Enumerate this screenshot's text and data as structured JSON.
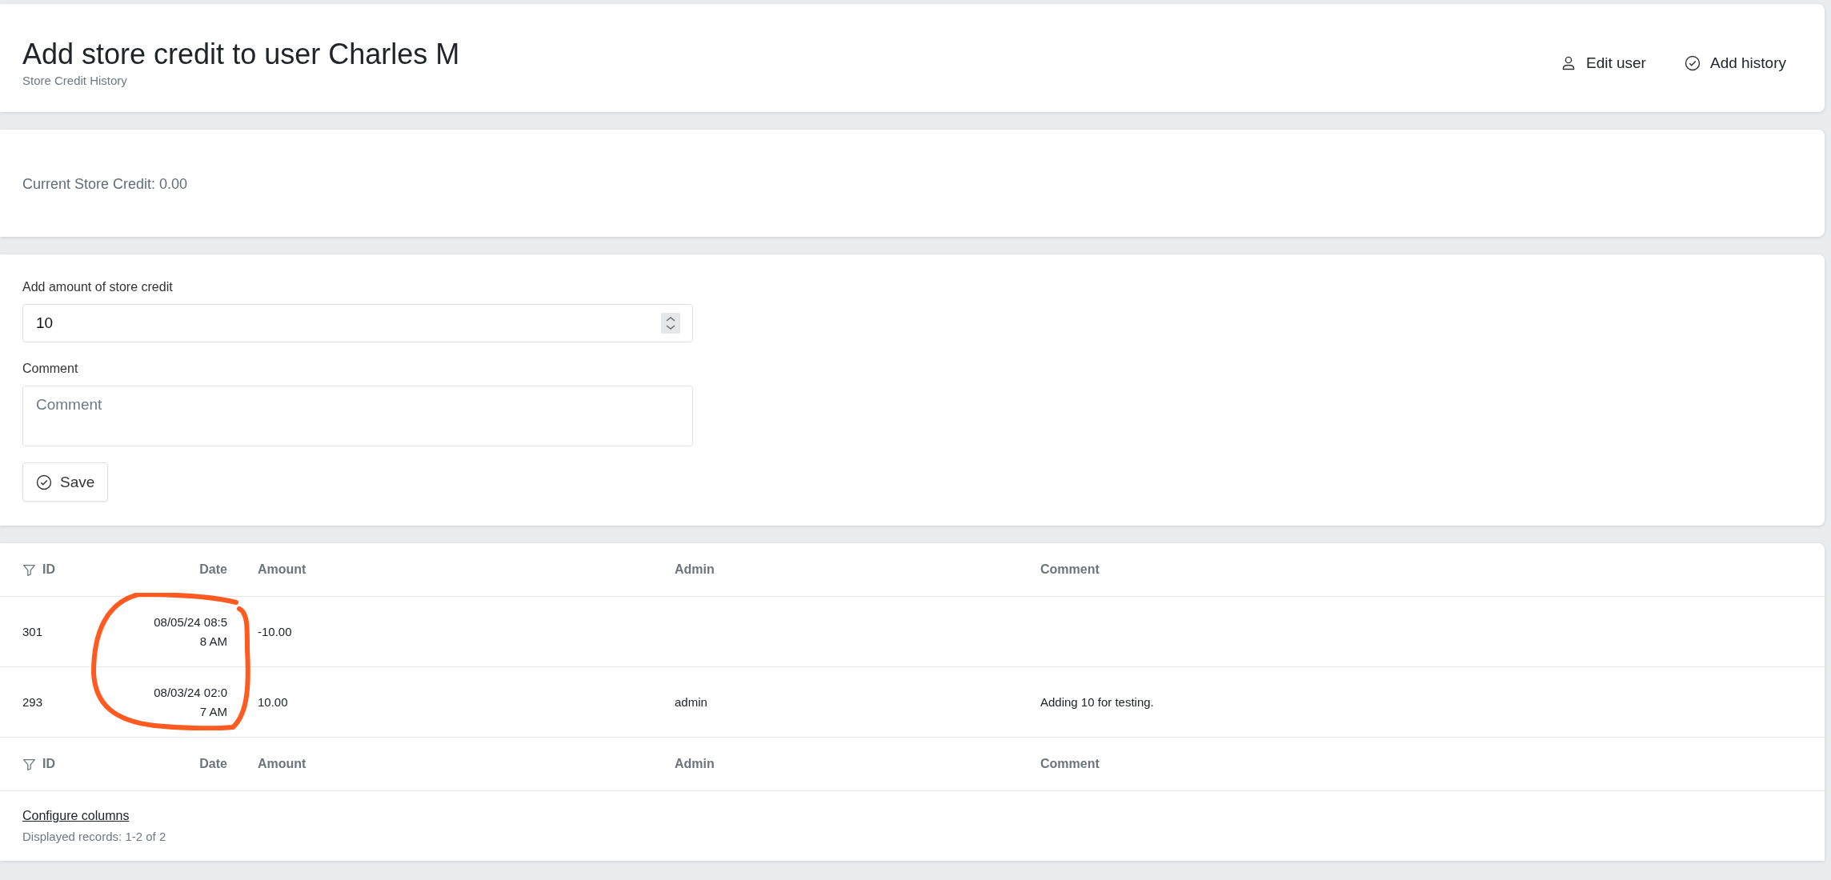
{
  "header": {
    "title": "Add store credit to user Charles M",
    "subtitle": "Store Credit History",
    "actions": [
      {
        "kind": "user",
        "label": "Edit user"
      },
      {
        "kind": "check",
        "label": "Add history"
      }
    ]
  },
  "balance": {
    "text": "Current Store Credit: 0.00"
  },
  "form": {
    "amount": {
      "label": "Add amount of store credit",
      "value": "10"
    },
    "comment": {
      "label": "Comment",
      "placeholder": "Comment"
    },
    "save_button": {
      "label": "Save"
    }
  },
  "table": {
    "columns": [
      {
        "label": "ID",
        "filter": true
      },
      {
        "label": "Date",
        "filter": false
      },
      {
        "label": "Amount",
        "filter": false
      },
      {
        "label": "Admin",
        "filter": false
      },
      {
        "label": "Comment",
        "filter": false
      }
    ],
    "rows": [
      [
        "301",
        "08/05/24 08:58 AM",
        "-10.00",
        "",
        ""
      ],
      [
        "293",
        "08/03/24 02:07 AM",
        "10.00",
        "admin",
        "Adding 10 for testing."
      ]
    ],
    "footer_columns": [
      {
        "label": "ID",
        "filter": true
      },
      {
        "label": "Date",
        "filter": false
      },
      {
        "label": "Amount",
        "filter": false
      },
      {
        "label": "Admin",
        "filter": false
      },
      {
        "label": "Comment",
        "filter": false
      }
    ],
    "configure_link": "Configure columns",
    "record_count": "Displayed records: 1-2 of 2"
  },
  "annotation": {
    "kind": "freehand-circle"
  }
}
